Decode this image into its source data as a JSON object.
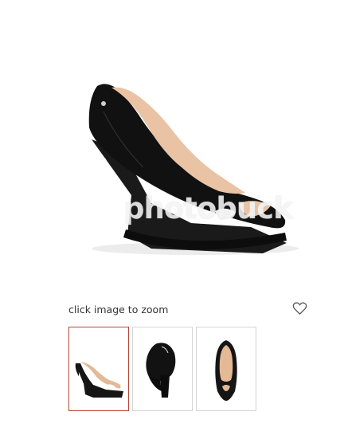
{
  "product": {
    "main_image_icon": "black-patent-peep-toe-wedge-shoe",
    "watermark_text": "photobuck"
  },
  "zoom": {
    "label": "click image to zoom",
    "wishlist_icon": "heart-outline-icon"
  },
  "thumbnails": [
    {
      "icon": "shoe-side-view",
      "selected": true
    },
    {
      "icon": "shoe-back-view",
      "selected": false
    },
    {
      "icon": "shoe-top-view",
      "selected": false
    }
  ],
  "colors": {
    "selected_thumb_border": "#b9443a",
    "thumb_border": "#d4d4d4"
  }
}
